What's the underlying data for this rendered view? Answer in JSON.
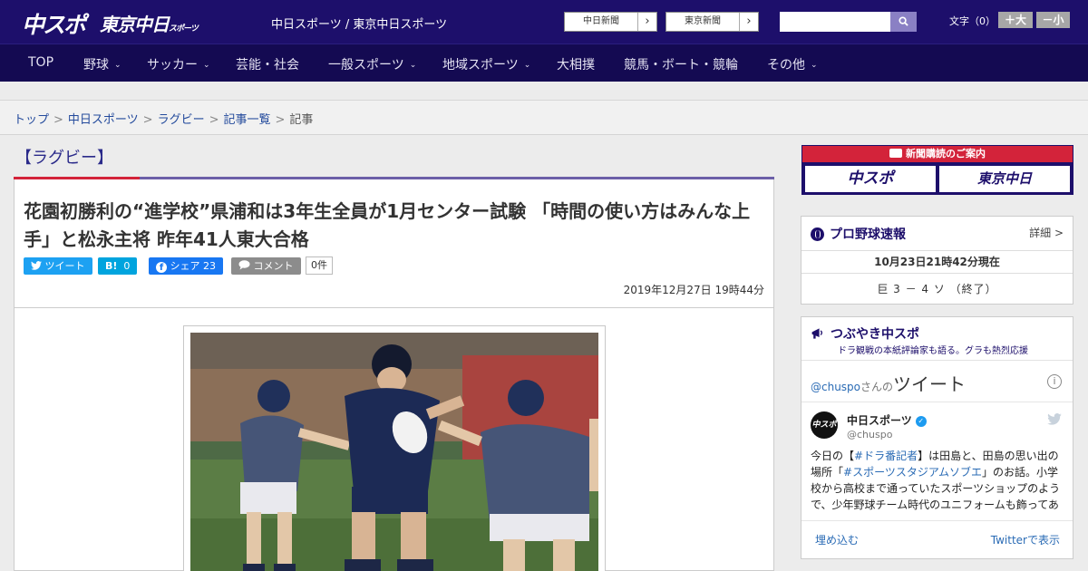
{
  "header": {
    "logo_chuspo": "中スポ",
    "logo_tokyo": "東京中日",
    "logo_tokyo_small": "スポーツ",
    "site_title": "中日スポーツ / 東京中日スポーツ",
    "ext_links": [
      {
        "label": "中日新聞",
        "arrow": "›"
      },
      {
        "label": "東京新聞",
        "arrow": "›"
      }
    ],
    "search_placeholder": "",
    "font_label": "文字（0）",
    "font_larger": "＋大",
    "font_smaller": "－小"
  },
  "nav": {
    "items": [
      {
        "label": "TOP",
        "chevron": ""
      },
      {
        "label": "野球",
        "chevron": "⌄"
      },
      {
        "label": "サッカー",
        "chevron": "⌄"
      },
      {
        "label": "芸能・社会",
        "chevron": ""
      },
      {
        "label": "一般スポーツ",
        "chevron": "⌄"
      },
      {
        "label": "地域スポーツ",
        "chevron": "⌄"
      },
      {
        "label": "大相撲",
        "chevron": ""
      },
      {
        "label": "競馬・ボート・競輪",
        "chevron": ""
      },
      {
        "label": "その他",
        "chevron": "⌄"
      }
    ]
  },
  "breadcrumb": {
    "items": [
      "トップ",
      "中日スポーツ",
      "ラグビー",
      "記事一覧"
    ],
    "separator": ">",
    "current": "記事"
  },
  "article": {
    "category": "【ラグビー】",
    "headline": "花園初勝利の“進学校”県浦和は3年生全員が1月センター試験 「時間の使い方はみんな上手」と松永主将 昨年41人東大合格",
    "share": {
      "tweet": "ツイート",
      "hatena_icon": "B!",
      "hatena_count": "0",
      "facebook": "シェア 23",
      "comment": "コメント",
      "comment_count": "0件"
    },
    "date": "2019年12月27日 19時44分"
  },
  "sidebar": {
    "ad": {
      "title": "新聞購読のご案内",
      "logo1": "中スポ",
      "logo2": "東京中日"
    },
    "baseball": {
      "title": "プロ野球速報",
      "detail": "詳細 >",
      "time": "10月23日21時42分現在",
      "score": "巨 3 － 4 ソ （終了）"
    },
    "tweets": {
      "title": "つぶやき中スポ",
      "subtitle": "ドラ観戦の本紙評論家も語る。グラも熱烈応援",
      "handle": "@chuspo",
      "handle_suffix": "さんの",
      "heading": "ツイート",
      "info_icon": "i",
      "avatar_text": "中スポ",
      "name": "中日スポーツ",
      "username": "@chuspo",
      "text_1": "今日の【",
      "hashtag_1": "#ドラ番記者",
      "text_2": "】は田島と、田島の思い出の場所「",
      "hashtag_2": "#スポーツスタジアムソブエ",
      "text_3": "」のお話。小学校から高校まで通っていたスポーツショップのようで、少年野球チーム時代のユニフォームも飾ってあ",
      "embed": "埋め込む",
      "view": "Twitterで表示"
    }
  },
  "colors": {
    "header_bg": "#1d0f6b",
    "nav_bg": "#140a52",
    "accent_red": "#d3233a",
    "accent_purple": "#6c5fa8",
    "twitter": "#1da1f2",
    "facebook": "#1877f2",
    "hatena": "#00a4de"
  }
}
